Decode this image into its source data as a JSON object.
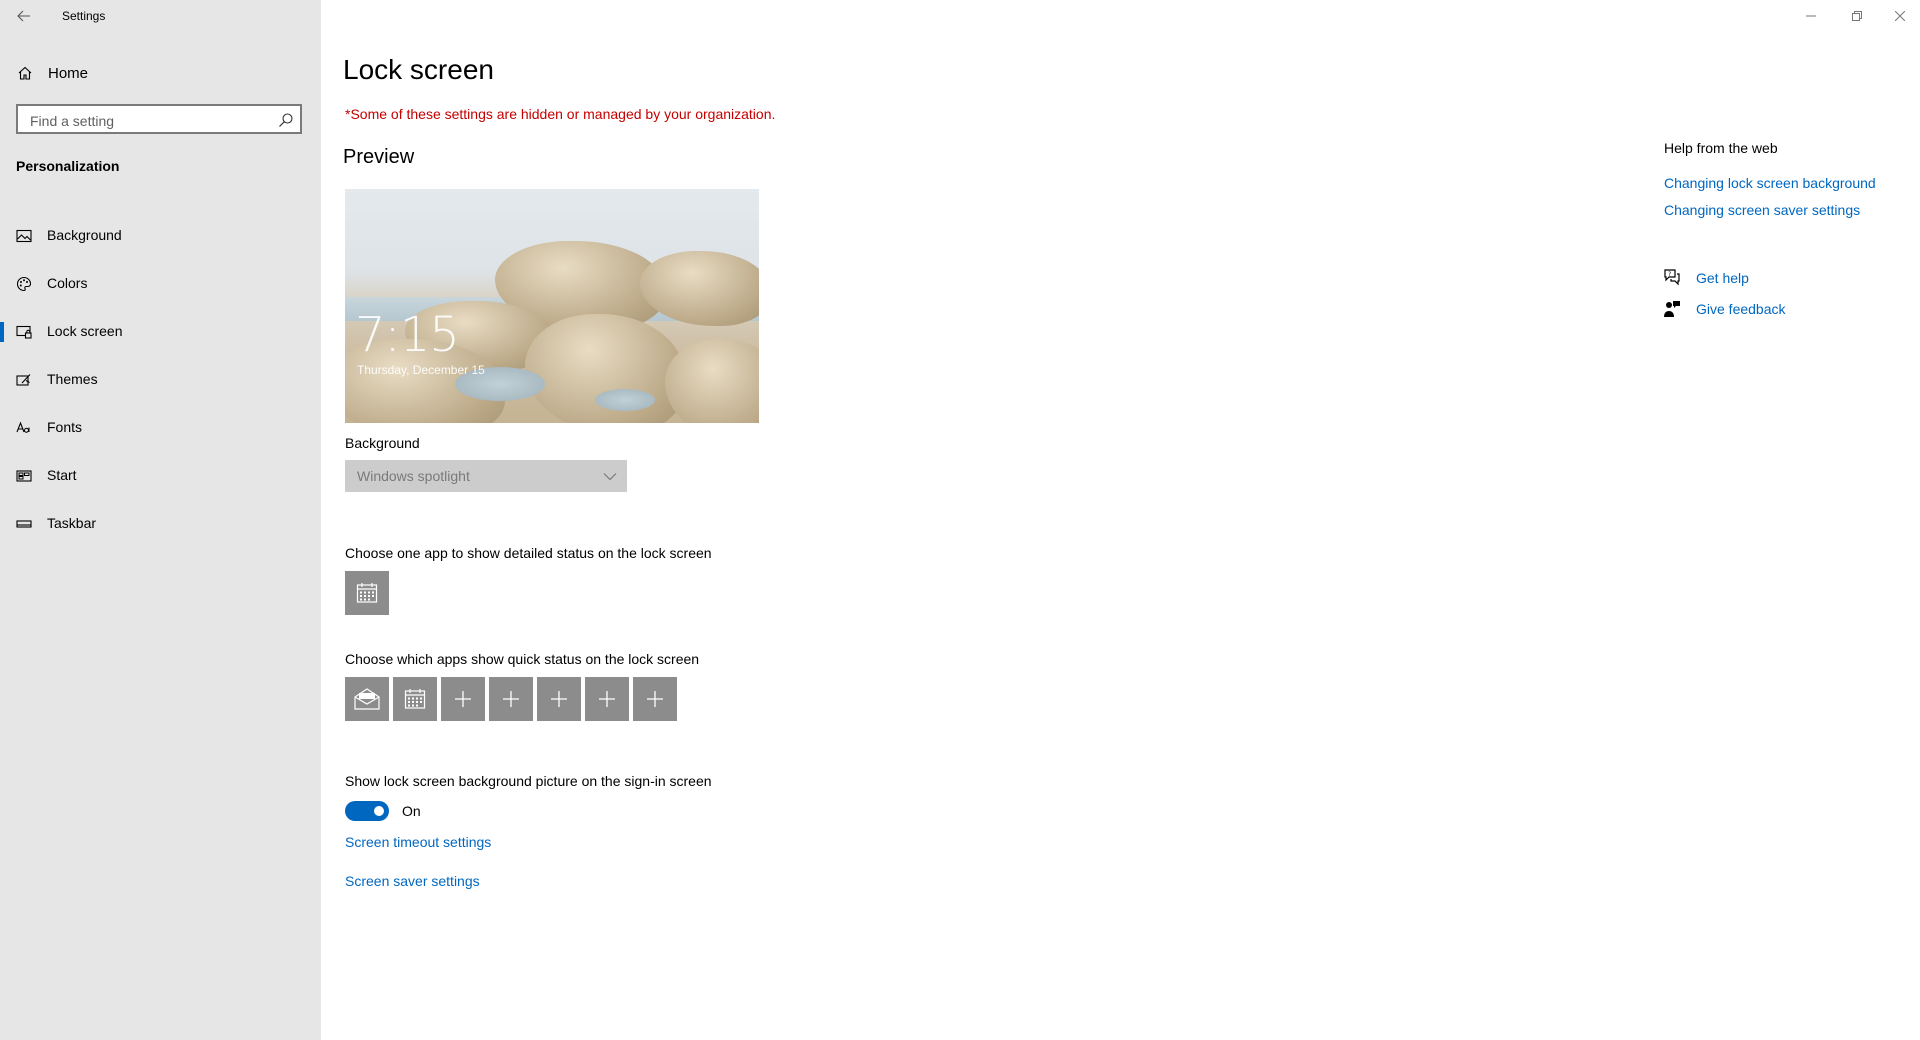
{
  "window": {
    "title": "Settings"
  },
  "sidebar": {
    "home_label": "Home",
    "search_placeholder": "Find a setting",
    "section_title": "Personalization",
    "items": [
      {
        "label": "Background",
        "icon": "image-icon"
      },
      {
        "label": "Colors",
        "icon": "palette-icon"
      },
      {
        "label": "Lock screen",
        "icon": "lock-screen-icon",
        "selected": true
      },
      {
        "label": "Themes",
        "icon": "themes-icon"
      },
      {
        "label": "Fonts",
        "icon": "fonts-icon"
      },
      {
        "label": "Start",
        "icon": "start-icon"
      },
      {
        "label": "Taskbar",
        "icon": "taskbar-icon"
      }
    ]
  },
  "main": {
    "title": "Lock screen",
    "org_note": "*Some of these settings are hidden or managed by your organization.",
    "preview_heading": "Preview",
    "preview": {
      "time": "7:15",
      "date": "Thursday, December 15"
    },
    "background_label": "Background",
    "background_value": "Windows spotlight",
    "detailed_status_label": "Choose one app to show detailed status on the lock screen",
    "quick_status_label": "Choose which apps show quick status on the lock screen",
    "quick_status_apps": [
      "mail-icon",
      "calendar-icon",
      "plus-icon",
      "plus-icon",
      "plus-icon",
      "plus-icon",
      "plus-icon"
    ],
    "signin_label": "Show lock screen background picture on the sign-in screen",
    "signin_toggle_state": "On",
    "signin_toggle_on": true,
    "screen_timeout_link": "Screen timeout settings",
    "screen_saver_link": "Screen saver settings"
  },
  "help": {
    "title": "Help from the web",
    "links": [
      "Changing lock screen background",
      "Changing screen saver settings"
    ],
    "get_help": "Get help",
    "give_feedback": "Give feedback"
  },
  "colors": {
    "accent": "#0067c0",
    "warning": "#c50000",
    "sidebar_bg": "#e6e6e6",
    "tile_bg": "#8c8c8c"
  }
}
